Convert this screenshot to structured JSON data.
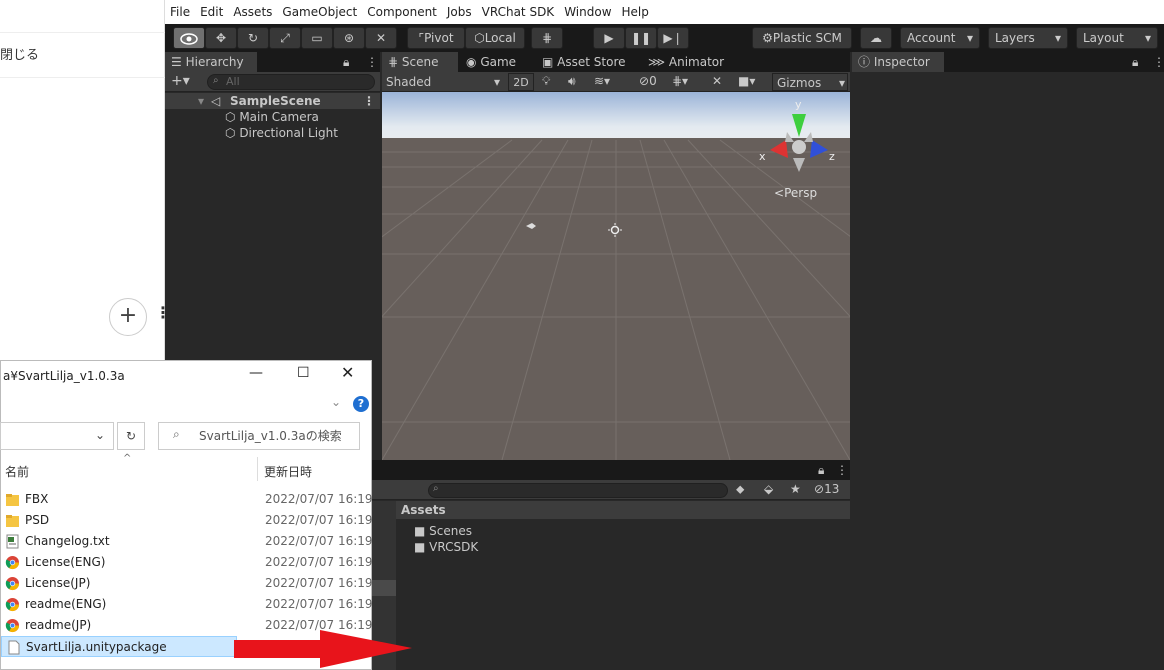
{
  "left_panel": {
    "close_label": "閉じる",
    "plus": "+",
    "dots": "⋮"
  },
  "menu": [
    "File",
    "Edit",
    "Assets",
    "GameObject",
    "Component",
    "Jobs",
    "VRChat SDK",
    "Window",
    "Help"
  ],
  "toolbar": {
    "pivot": "Pivot",
    "local": "Local",
    "plastic": "Plastic SCM",
    "account": "Account",
    "layers": "Layers",
    "layout": "Layout"
  },
  "hierarchy": {
    "tab": "Hierarchy",
    "search_placeholder": "All",
    "scene": "SampleScene",
    "items": [
      "Main Camera",
      "Directional Light"
    ]
  },
  "scene_view": {
    "tabs": [
      "Scene",
      "Game",
      "Asset Store",
      "Animator"
    ],
    "shading": "Shaded",
    "mode_2d": "2D",
    "hidden_count": "0",
    "gizmos": "Gizmos",
    "persp": "Persp",
    "axes": {
      "y": "y",
      "x": "x",
      "z": "z"
    }
  },
  "inspector": {
    "tab": "Inspector"
  },
  "project": {
    "hidden_count": "13",
    "assets_header": "Assets",
    "folders": [
      "Scenes",
      "VRCSDK"
    ]
  },
  "explorer": {
    "title": "a¥SvartLilja_v1.0.3a",
    "search_placeholder": "SvartLilja_v1.0.3aの検索",
    "col_name": "名前",
    "col_date": "更新日時",
    "files": [
      {
        "name": "FBX",
        "date": "2022/07/07 16:19",
        "icon": "folder-icon"
      },
      {
        "name": "PSD",
        "date": "2022/07/07 16:19",
        "icon": "folder-icon"
      },
      {
        "name": "Changelog.txt",
        "date": "2022/07/07 16:19",
        "icon": "text-file-icon"
      },
      {
        "name": "License(ENG)",
        "date": "2022/07/07 16:19",
        "icon": "chrome-icon"
      },
      {
        "name": "License(JP)",
        "date": "2022/07/07 16:19",
        "icon": "chrome-icon"
      },
      {
        "name": "readme(ENG)",
        "date": "2022/07/07 16:19",
        "icon": "chrome-icon"
      },
      {
        "name": "readme(JP)",
        "date": "2022/07/07 16:19",
        "icon": "chrome-icon"
      },
      {
        "name": "SvartLilja.unitypackage",
        "date": "",
        "icon": "file-icon"
      }
    ]
  },
  "colors": {
    "arrow": "#e8141b",
    "selection": "#cce8ff",
    "unity_dark": "#282828"
  }
}
